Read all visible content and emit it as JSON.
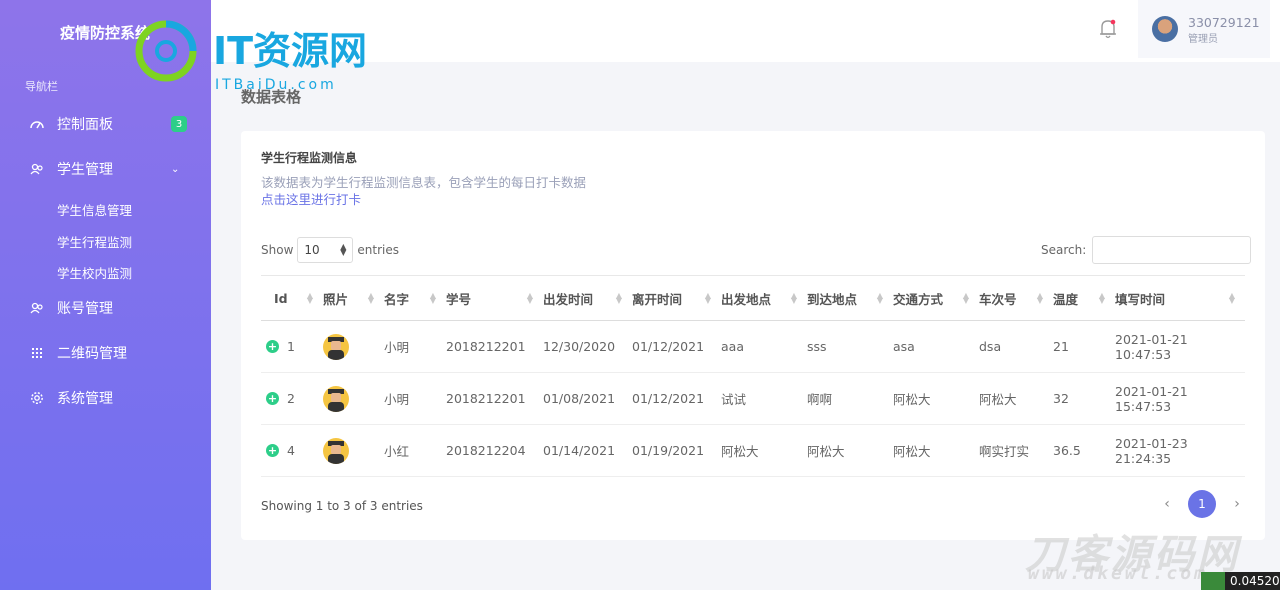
{
  "app": {
    "brand": "疫情防控系统"
  },
  "logo": {
    "main": "IT资源网",
    "sub": "ITBaiDu.com"
  },
  "sidebar": {
    "section_label": "导航栏",
    "items": [
      {
        "label": "控制面板",
        "badge": "3",
        "icon": "dashboard-icon"
      },
      {
        "label": "学生管理",
        "icon": "users-icon"
      },
      {
        "label": "账号管理",
        "icon": "users-icon"
      },
      {
        "label": "二维码管理",
        "icon": "grid-icon"
      },
      {
        "label": "系统管理",
        "icon": "gear-icon"
      }
    ],
    "subitems": [
      "学生信息管理",
      "学生行程监测",
      "学生校内监测"
    ]
  },
  "header": {
    "username": "330729121",
    "role": "管理员"
  },
  "page": {
    "title": "数据表格"
  },
  "card": {
    "title": "学生行程监测信息",
    "description": "该数据表为学生行程监测信息表，包含学生的每日打卡数据",
    "link": "点击这里进行打卡"
  },
  "table_controls": {
    "show": "Show",
    "length": "10",
    "entries": "entries",
    "search_label": "Search:"
  },
  "table": {
    "columns": [
      "Id",
      "照片",
      "名字",
      "学号",
      "出发时间",
      "离开时间",
      "出发地点",
      "到达地点",
      "交通方式",
      "车次号",
      "温度",
      "填写时间"
    ],
    "rows": [
      {
        "id": "1",
        "name": "小明",
        "sid": "2018212201",
        "depart": "12/30/2020",
        "leave": "01/12/2021",
        "from": "aaa",
        "to": "sss",
        "transport": "asa",
        "train": "dsa",
        "temp": "21",
        "filled": "2021-01-21 10:47:53"
      },
      {
        "id": "2",
        "name": "小明",
        "sid": "2018212201",
        "depart": "01/08/2021",
        "leave": "01/12/2021",
        "from": "试试",
        "to": "啊啊",
        "transport": "阿松大",
        "train": "阿松大",
        "temp": "32",
        "filled": "2021-01-21 15:47:53"
      },
      {
        "id": "4",
        "name": "小红",
        "sid": "2018212204",
        "depart": "01/14/2021",
        "leave": "01/19/2021",
        "from": "阿松大",
        "to": "阿松大",
        "transport": "阿松大",
        "train": "啊实打实",
        "temp": "36.5",
        "filled": "2021-01-23 21:24:35"
      }
    ]
  },
  "footer": {
    "info": "Showing 1 to 3 of 3 entries",
    "prev": "‹",
    "page": "1",
    "next": "›"
  },
  "watermark": {
    "text": "刀客源码网",
    "url": "www.dkewl.com"
  },
  "corner": {
    "value": "0.04520"
  },
  "colors": {
    "sidebar_top": "#8e74ea",
    "sidebar_bottom": "#6f6ff0",
    "accent": "#6a73e6",
    "success": "#2dce89"
  }
}
